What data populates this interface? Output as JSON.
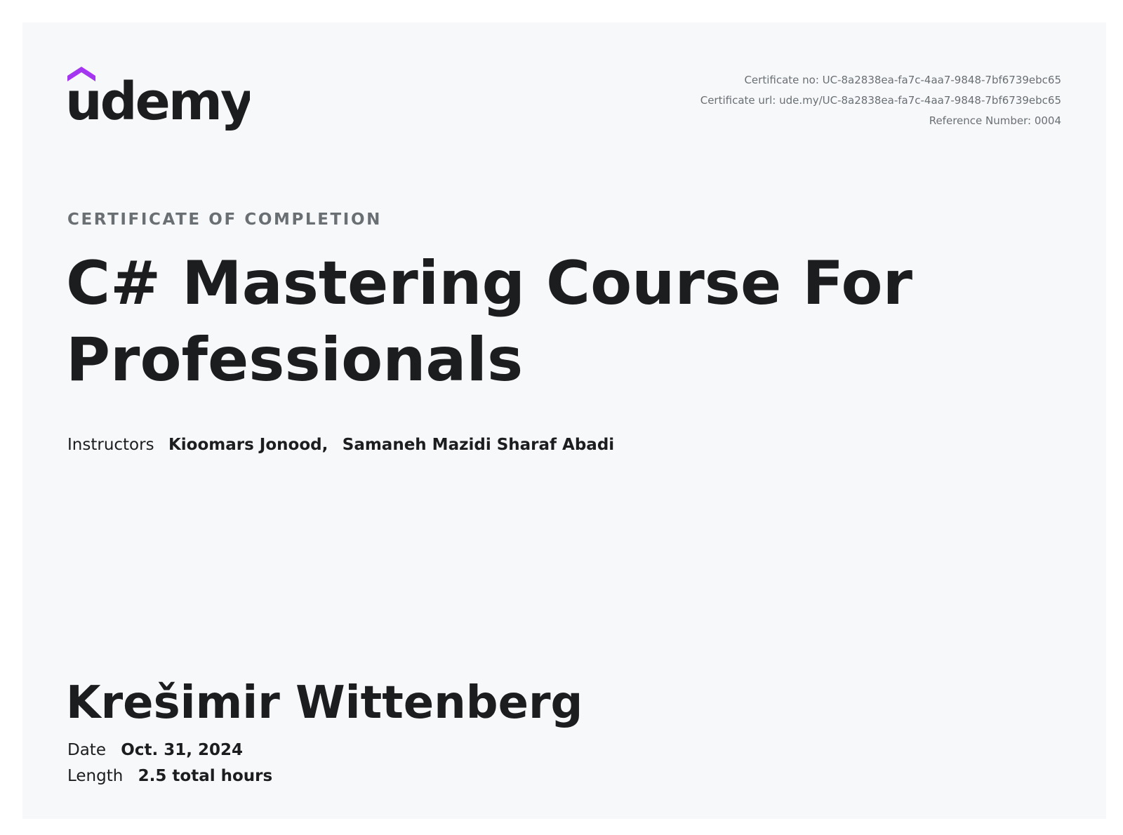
{
  "brand": {
    "name": "udemy",
    "accent_color": "#a435f0",
    "text_color": "#1c1d1f"
  },
  "certificate_meta": {
    "certificate_no": "Certificate no: UC-8a2838ea-fa7c-4aa7-9848-7bf6739ebc65",
    "certificate_url": "Certificate url: ude.my/UC-8a2838ea-fa7c-4aa7-9848-7bf6739ebc65",
    "reference_number": "Reference Number: 0004"
  },
  "heading": {
    "eyebrow": "CERTIFICATE OF COMPLETION",
    "course_title": "C# Mastering Course For Professionals"
  },
  "instructors": {
    "label": "Instructors",
    "names": [
      "Kioomars Jonood",
      "Samaneh Mazidi Sharaf Abadi"
    ],
    "separator": ","
  },
  "recipient": {
    "name": "Krešimir Wittenberg"
  },
  "details": {
    "date_label": "Date",
    "date_value": "Oct. 31, 2024",
    "length_label": "Length",
    "length_value": "2.5 total hours"
  },
  "colors": {
    "page_background": "#ffffff",
    "card_background": "#f7f8fa",
    "muted_text": "#6a6f73"
  }
}
